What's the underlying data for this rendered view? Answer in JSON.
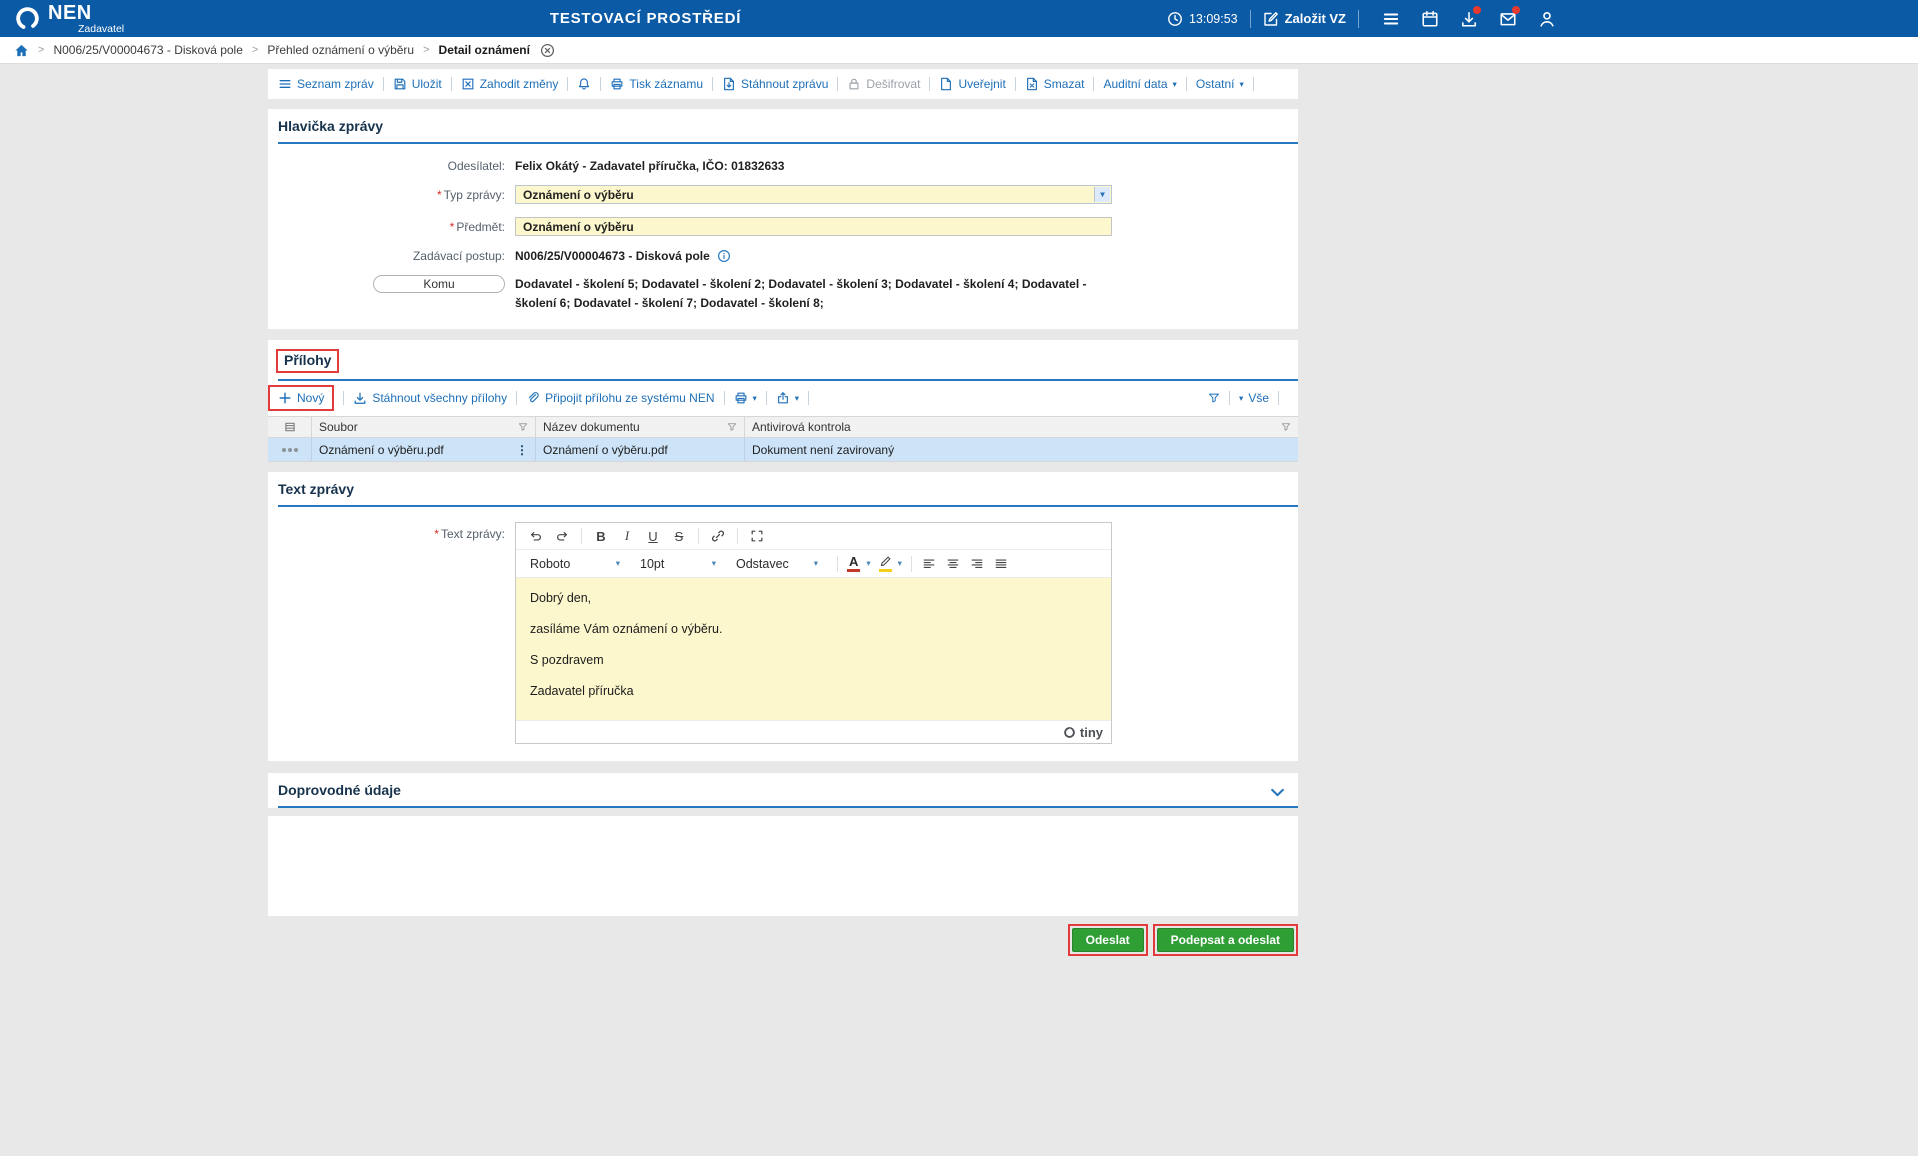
{
  "topbar": {
    "logo_text": "NEN",
    "logo_subtext": "Zadavatel",
    "env_title": "TESTOVACÍ PROSTŘEDÍ",
    "time": "13:09:53",
    "create_label": "Založit VZ"
  },
  "breadcrumb": {
    "items": [
      "N006/25/V00004673 - Disková pole",
      "Přehled oznámení o výběru",
      "Detail oznámení"
    ]
  },
  "toolbar": {
    "seznam_zprav": "Seznam zpráv",
    "ulozit": "Uložit",
    "zahodit_zmeny": "Zahodit změny",
    "tisk_zaznamu": "Tisk záznamu",
    "stahnout_zpravu": "Stáhnout zprávu",
    "desifrovat": "Dešifrovat",
    "uverejnit": "Uveřejnit",
    "smazat": "Smazat",
    "auditni_data": "Auditní data",
    "ostatni": "Ostatní"
  },
  "message_header": {
    "title": "Hlavička zprávy",
    "sender_label": "Odesílatel:",
    "sender_value": "Felix Okátý - Zadavatel příručka, IČO: 01832633",
    "type_label": "Typ zprávy:",
    "type_value": "Oznámení o výběru",
    "subject_label": "Předmět:",
    "subject_value": "Oznámení o výběru",
    "procedure_label": "Zadávací postup:",
    "procedure_value": "N006/25/V00004673 - Disková pole",
    "to_label": "Komu",
    "to_value": "Dodavatel - školení 5; Dodavatel - školení 2; Dodavatel - školení 3; Dodavatel - školení 4; Dodavatel - školení 6; Dodavatel - školení 7; Dodavatel - školení 8;"
  },
  "attachments": {
    "title": "Přílohy",
    "novy": "Nový",
    "stahnout_vse": "Stáhnout všechny přílohy",
    "pripojit": "Připojit přílohu ze systému NEN",
    "vse": "Vše",
    "columns": [
      "Soubor",
      "Název dokumentu",
      "Antivirová kontrola"
    ],
    "rows": [
      {
        "soubor": "Oznámení o výběru.pdf",
        "nazev_dokumentu": "Oznámení o výběru.pdf",
        "antivirova_kontrola": "Dokument není zavirovaný"
      }
    ]
  },
  "message_text": {
    "title": "Text zprávy",
    "field_label": "Text zprávy:",
    "editor": {
      "font_family": "Roboto",
      "font_size": "10pt",
      "block_format": "Odstavec",
      "paragraphs": [
        "Dobrý den,",
        "zasíláme Vám oznámení o výběru.",
        "S pozdravem",
        "Zadavatel příručka"
      ],
      "brand": "tiny"
    }
  },
  "additional_section": {
    "title": "Doprovodné údaje"
  },
  "footer": {
    "odeslat": "Odeslat",
    "podepsat_a_odeslat": "Podepsat a odeslat"
  },
  "glyphs": {
    "required": "*",
    "chevron": "▾",
    "crumb_sep": ">",
    "row_menu": "⋮",
    "bold": "B",
    "italic": "I",
    "underline": "U",
    "strike": "S",
    "color_a": "A"
  },
  "colors": {
    "header_bg": "#0b5aa6",
    "accent_blue": "#1d6fb8",
    "section_underline": "#2878bf",
    "input_yellow": "#fcf7cd",
    "selected_row": "#cde3f7",
    "button_green": "#2f9e35",
    "annotation_red": "#e23b3b"
  }
}
